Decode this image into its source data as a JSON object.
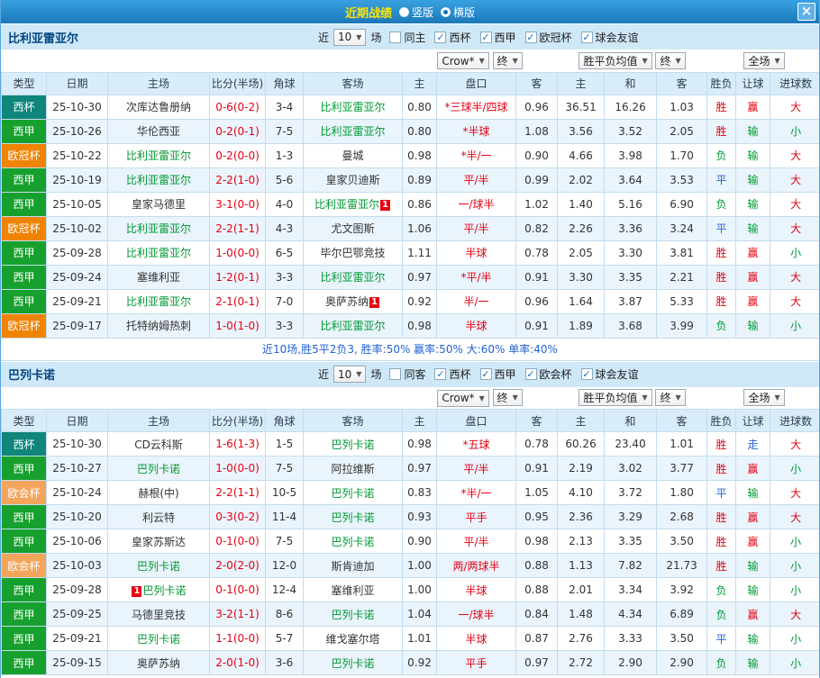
{
  "titlebar": {
    "title": "近期战绩",
    "radios": [
      {
        "label": "竖版",
        "selected": false
      },
      {
        "label": "横版",
        "selected": true
      }
    ],
    "close_label": "×"
  },
  "colors": {
    "types": {
      "西杯": "#0f857b",
      "西甲": "#17a02e",
      "欧冠杯": "#f08300",
      "欧会杯": "#f3a55c"
    },
    "win": "#e60012",
    "lose": "#009933",
    "draw": "#2262d6",
    "team_highlight": "#009933",
    "score": "#e60012",
    "handicap": "#e60012",
    "badge": "#e60012",
    "check": "#1a6fc4",
    "summary": "#2262d6"
  },
  "sections": [
    {
      "team": "比利亚雷亚尔",
      "near_label": "近",
      "match_count": "10",
      "games_label": "场",
      "checkboxes": [
        {
          "label": "同主",
          "checked": false
        },
        {
          "label": "西杯",
          "checked": true
        },
        {
          "label": "西甲",
          "checked": true
        },
        {
          "label": "欧冠杯",
          "checked": true
        },
        {
          "label": "球会友谊",
          "checked": true
        }
      ],
      "dropdowns": {
        "company": "Crow*",
        "final1": "终",
        "avg": "胜平负均值",
        "final2": "终",
        "scope": "全场"
      },
      "columns": [
        "类型",
        "日期",
        "主场",
        "比分(半场)",
        "角球",
        "客场",
        "主",
        "盘口",
        "客",
        "主",
        "和",
        "客",
        "胜负",
        "让球",
        "进球数"
      ],
      "rows": [
        {
          "type": "西杯",
          "date": "25-10-30",
          "home": "次库达鲁册纳",
          "home_highlight": false,
          "home_badge": "",
          "score": "0-6(0-2)",
          "corners": "3-4",
          "away": "比利亚雷亚尔",
          "away_highlight": true,
          "away_badge": "",
          "odds_home": "0.80",
          "handicap": "*三球半/四球",
          "odds_away": "0.96",
          "avg_home": "36.51",
          "avg_draw": "16.26",
          "avg_away": "1.03",
          "result": "胜",
          "handicap_result": "赢",
          "goals_result": "大"
        },
        {
          "type": "西甲",
          "date": "25-10-26",
          "home": "华伦西亚",
          "home_highlight": false,
          "home_badge": "",
          "score": "0-2(0-1)",
          "corners": "7-5",
          "away": "比利亚雷亚尔",
          "away_highlight": true,
          "away_badge": "",
          "odds_home": "0.80",
          "handicap": "*半球",
          "odds_away": "1.08",
          "avg_home": "3.56",
          "avg_draw": "3.52",
          "avg_away": "2.05",
          "result": "胜",
          "handicap_result": "输",
          "goals_result": "小"
        },
        {
          "type": "欧冠杯",
          "date": "25-10-22",
          "home": "比利亚雷亚尔",
          "home_highlight": true,
          "home_badge": "",
          "score": "0-2(0-0)",
          "corners": "1-3",
          "away": "曼城",
          "away_highlight": false,
          "away_badge": "",
          "odds_home": "0.98",
          "handicap": "*半/一",
          "odds_away": "0.90",
          "avg_home": "4.66",
          "avg_draw": "3.98",
          "avg_away": "1.70",
          "result": "负",
          "handicap_result": "输",
          "goals_result": "大"
        },
        {
          "type": "西甲",
          "date": "25-10-19",
          "home": "比利亚雷亚尔",
          "home_highlight": true,
          "home_badge": "",
          "score": "2-2(1-0)",
          "corners": "5-6",
          "away": "皇家贝迪斯",
          "away_highlight": false,
          "away_badge": "",
          "odds_home": "0.89",
          "handicap": "平/半",
          "odds_away": "0.99",
          "avg_home": "2.02",
          "avg_draw": "3.64",
          "avg_away": "3.53",
          "result": "平",
          "handicap_result": "输",
          "goals_result": "大"
        },
        {
          "type": "西甲",
          "date": "25-10-05",
          "home": "皇家马德里",
          "home_highlight": false,
          "home_badge": "",
          "score": "3-1(0-0)",
          "corners": "4-0",
          "away": "比利亚雷亚尔",
          "away_highlight": true,
          "away_badge": "1",
          "odds_home": "0.86",
          "handicap": "一/球半",
          "odds_away": "1.02",
          "avg_home": "1.40",
          "avg_draw": "5.16",
          "avg_away": "6.90",
          "result": "负",
          "handicap_result": "输",
          "goals_result": "大"
        },
        {
          "type": "欧冠杯",
          "date": "25-10-02",
          "home": "比利亚雷亚尔",
          "home_highlight": true,
          "home_badge": "",
          "score": "2-2(1-1)",
          "corners": "4-3",
          "away": "尤文图斯",
          "away_highlight": false,
          "away_badge": "",
          "odds_home": "1.06",
          "handicap": "平/半",
          "odds_away": "0.82",
          "avg_home": "2.26",
          "avg_draw": "3.36",
          "avg_away": "3.24",
          "result": "平",
          "handicap_result": "输",
          "goals_result": "大"
        },
        {
          "type": "西甲",
          "date": "25-09-28",
          "home": "比利亚雷亚尔",
          "home_highlight": true,
          "home_badge": "",
          "score": "1-0(0-0)",
          "corners": "6-5",
          "away": "毕尔巴鄂竞技",
          "away_highlight": false,
          "away_badge": "",
          "odds_home": "1.11",
          "handicap": "半球",
          "odds_away": "0.78",
          "avg_home": "2.05",
          "avg_draw": "3.30",
          "avg_away": "3.81",
          "result": "胜",
          "handicap_result": "赢",
          "goals_result": "小"
        },
        {
          "type": "西甲",
          "date": "25-09-24",
          "home": "塞维利亚",
          "home_highlight": false,
          "home_badge": "",
          "score": "1-2(0-1)",
          "corners": "3-3",
          "away": "比利亚雷亚尔",
          "away_highlight": true,
          "away_badge": "",
          "odds_home": "0.97",
          "handicap": "*平/半",
          "odds_away": "0.91",
          "avg_home": "3.30",
          "avg_draw": "3.35",
          "avg_away": "2.21",
          "result": "胜",
          "handicap_result": "赢",
          "goals_result": "大"
        },
        {
          "type": "西甲",
          "date": "25-09-21",
          "home": "比利亚雷亚尔",
          "home_highlight": true,
          "home_badge": "",
          "score": "2-1(0-1)",
          "corners": "7-0",
          "away": "奥萨苏纳",
          "away_highlight": false,
          "away_badge": "1",
          "odds_home": "0.92",
          "handicap": "半/一",
          "odds_away": "0.96",
          "avg_home": "1.64",
          "avg_draw": "3.87",
          "avg_away": "5.33",
          "result": "胜",
          "handicap_result": "赢",
          "goals_result": "大"
        },
        {
          "type": "欧冠杯",
          "date": "25-09-17",
          "home": "托特纳姆热刺",
          "home_highlight": false,
          "home_badge": "",
          "score": "1-0(1-0)",
          "corners": "3-3",
          "away": "比利亚雷亚尔",
          "away_highlight": true,
          "away_badge": "",
          "odds_home": "0.98",
          "handicap": "半球",
          "odds_away": "0.91",
          "avg_home": "1.89",
          "avg_draw": "3.68",
          "avg_away": "3.99",
          "result": "负",
          "handicap_result": "输",
          "goals_result": "小"
        }
      ],
      "summary": "近10场,胜5平2负3, 胜率:50% 赢率:50% 大:60% 单率:40%"
    },
    {
      "team": "巴列卡诺",
      "near_label": "近",
      "match_count": "10",
      "games_label": "场",
      "checkboxes": [
        {
          "label": "同客",
          "checked": false
        },
        {
          "label": "西杯",
          "checked": true
        },
        {
          "label": "西甲",
          "checked": true
        },
        {
          "label": "欧会杯",
          "checked": true
        },
        {
          "label": "球会友谊",
          "checked": true
        }
      ],
      "dropdowns": {
        "company": "Crow*",
        "final1": "终",
        "avg": "胜平负均值",
        "final2": "终",
        "scope": "全场"
      },
      "columns": [
        "类型",
        "日期",
        "主场",
        "比分(半场)",
        "角球",
        "客场",
        "主",
        "盘口",
        "客",
        "主",
        "和",
        "客",
        "胜负",
        "让球",
        "进球数"
      ],
      "rows": [
        {
          "type": "西杯",
          "date": "25-10-30",
          "home": "CD云科斯",
          "home_highlight": false,
          "home_badge": "",
          "score": "1-6(1-3)",
          "corners": "1-5",
          "away": "巴列卡诺",
          "away_highlight": true,
          "away_badge": "",
          "odds_home": "0.98",
          "handicap": "*五球",
          "odds_away": "0.78",
          "avg_home": "60.26",
          "avg_draw": "23.40",
          "avg_away": "1.01",
          "result": "胜",
          "handicap_result": "走",
          "goals_result": "大"
        },
        {
          "type": "西甲",
          "date": "25-10-27",
          "home": "巴列卡诺",
          "home_highlight": true,
          "home_badge": "",
          "score": "1-0(0-0)",
          "corners": "7-5",
          "away": "阿拉维斯",
          "away_highlight": false,
          "away_badge": "",
          "odds_home": "0.97",
          "handicap": "平/半",
          "odds_away": "0.91",
          "avg_home": "2.19",
          "avg_draw": "3.02",
          "avg_away": "3.77",
          "result": "胜",
          "handicap_result": "赢",
          "goals_result": "小"
        },
        {
          "type": "欧会杯",
          "date": "25-10-24",
          "home": "赫根(中)",
          "home_highlight": false,
          "home_badge": "",
          "score": "2-2(1-1)",
          "corners": "10-5",
          "away": "巴列卡诺",
          "away_highlight": true,
          "away_badge": "",
          "odds_home": "0.83",
          "handicap": "*半/一",
          "odds_away": "1.05",
          "avg_home": "4.10",
          "avg_draw": "3.72",
          "avg_away": "1.80",
          "result": "平",
          "handicap_result": "输",
          "goals_result": "大"
        },
        {
          "type": "西甲",
          "date": "25-10-20",
          "home": "利云特",
          "home_highlight": false,
          "home_badge": "",
          "score": "0-3(0-2)",
          "corners": "11-4",
          "away": "巴列卡诺",
          "away_highlight": true,
          "away_badge": "",
          "odds_home": "0.93",
          "handicap": "平手",
          "odds_away": "0.95",
          "avg_home": "2.36",
          "avg_draw": "3.29",
          "avg_away": "2.68",
          "result": "胜",
          "handicap_result": "赢",
          "goals_result": "大"
        },
        {
          "type": "西甲",
          "date": "25-10-06",
          "home": "皇家苏斯达",
          "home_highlight": false,
          "home_badge": "",
          "score": "0-1(0-0)",
          "corners": "7-5",
          "away": "巴列卡诺",
          "away_highlight": true,
          "away_badge": "",
          "odds_home": "0.90",
          "handicap": "平/半",
          "odds_away": "0.98",
          "avg_home": "2.13",
          "avg_draw": "3.35",
          "avg_away": "3.50",
          "result": "胜",
          "handicap_result": "赢",
          "goals_result": "小"
        },
        {
          "type": "欧会杯",
          "date": "25-10-03",
          "home": "巴列卡诺",
          "home_highlight": true,
          "home_badge": "",
          "score": "2-0(2-0)",
          "corners": "12-0",
          "away": "斯肯迪加",
          "away_highlight": false,
          "away_badge": "",
          "odds_home": "1.00",
          "handicap": "两/两球半",
          "odds_away": "0.88",
          "avg_home": "1.13",
          "avg_draw": "7.82",
          "avg_away": "21.73",
          "result": "胜",
          "handicap_result": "输",
          "goals_result": "小"
        },
        {
          "type": "西甲",
          "date": "25-09-28",
          "home": "巴列卡诺",
          "home_highlight": true,
          "home_badge": "1",
          "home_badge_before": true,
          "score": "0-1(0-0)",
          "corners": "12-4",
          "away": "塞维利亚",
          "away_highlight": false,
          "away_badge": "",
          "odds_home": "1.00",
          "handicap": "半球",
          "odds_away": "0.88",
          "avg_home": "2.01",
          "avg_draw": "3.34",
          "avg_away": "3.92",
          "result": "负",
          "handicap_result": "输",
          "goals_result": "小"
        },
        {
          "type": "西甲",
          "date": "25-09-25",
          "home": "马德里竞技",
          "home_highlight": false,
          "home_badge": "",
          "score": "3-2(1-1)",
          "corners": "8-6",
          "away": "巴列卡诺",
          "away_highlight": true,
          "away_badge": "",
          "odds_home": "1.04",
          "handicap": "一/球半",
          "odds_away": "0.84",
          "avg_home": "1.48",
          "avg_draw": "4.34",
          "avg_away": "6.89",
          "result": "负",
          "handicap_result": "赢",
          "goals_result": "大"
        },
        {
          "type": "西甲",
          "date": "25-09-21",
          "home": "巴列卡诺",
          "home_highlight": true,
          "home_badge": "",
          "score": "1-1(0-0)",
          "corners": "5-7",
          "away": "维戈塞尔塔",
          "away_highlight": false,
          "away_badge": "",
          "odds_home": "1.01",
          "handicap": "半球",
          "odds_away": "0.87",
          "avg_home": "2.76",
          "avg_draw": "3.33",
          "avg_away": "3.50",
          "result": "平",
          "handicap_result": "输",
          "goals_result": "小"
        },
        {
          "type": "西甲",
          "date": "25-09-15",
          "home": "奥萨苏纳",
          "home_highlight": false,
          "home_badge": "",
          "score": "2-0(1-0)",
          "corners": "3-6",
          "away": "巴列卡诺",
          "away_highlight": true,
          "away_badge": "",
          "odds_home": "0.92",
          "handicap": "平手",
          "odds_away": "0.97",
          "avg_home": "2.72",
          "avg_draw": "2.90",
          "avg_away": "2.90",
          "result": "负",
          "handicap_result": "输",
          "goals_result": "小"
        }
      ]
    }
  ]
}
